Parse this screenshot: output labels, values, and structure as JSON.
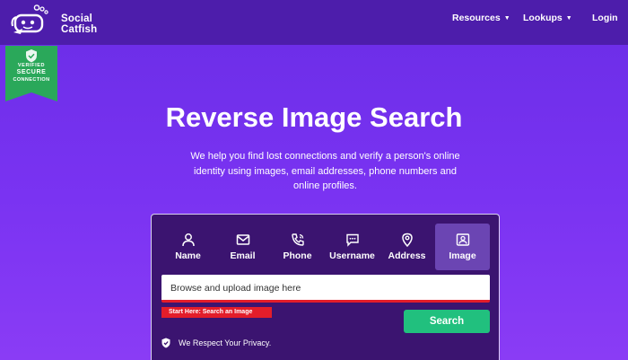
{
  "brand": {
    "name_line1": "Social",
    "name_line2": "Catfish"
  },
  "nav": {
    "resources": "Resources",
    "lookups": "Lookups",
    "login": "Login"
  },
  "ribbon": {
    "line1": "VERIFIED",
    "line2": "SECURE",
    "line3": "CONNECTION"
  },
  "hero": {
    "title": "Reverse Image Search",
    "subtitle": "We help you find lost connections and verify a person's online identity using images, email addresses, phone numbers and online profiles."
  },
  "search_card": {
    "tabs": [
      {
        "label": "Name",
        "icon": "person-icon"
      },
      {
        "label": "Email",
        "icon": "envelope-icon"
      },
      {
        "label": "Phone",
        "icon": "phone-icon"
      },
      {
        "label": "Username",
        "icon": "chat-icon"
      },
      {
        "label": "Address",
        "icon": "map-pin-icon"
      },
      {
        "label": "Image",
        "icon": "image-icon"
      }
    ],
    "active_tab": "Image",
    "input_placeholder": "Browse and upload image here",
    "start_badge": "Start Here: Search an Image",
    "search_button": "Search",
    "privacy_text": "We Respect Your Privacy."
  },
  "colors": {
    "topbar": "#4d1dab",
    "background": "#7a33f2",
    "card": "#3b1470",
    "active_tab": "#6b45b3",
    "search_button": "#21c07e",
    "alert_red": "#e31d2a",
    "ribbon_green": "#2aa85a"
  }
}
